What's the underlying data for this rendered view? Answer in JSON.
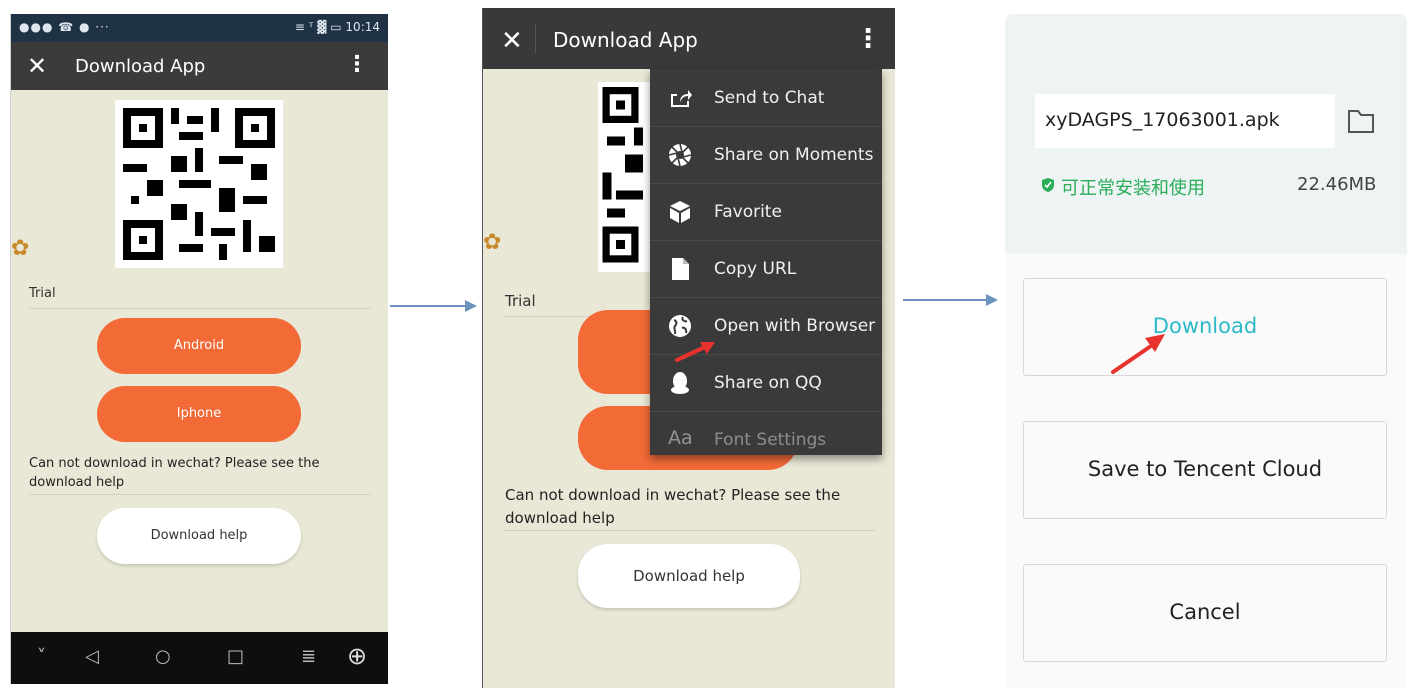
{
  "phone1": {
    "status": {
      "left_icons": "●●● ☎ ● ···",
      "right": "≡ ᵀ ▓ ▭ 10:14"
    },
    "appbar": {
      "close": "✕",
      "title": "Download App",
      "more": "⋮"
    },
    "trial_label": "Trial",
    "android_button": "Android",
    "iphone_button": "Iphone",
    "note": "Can not download in wechat?  Please see the download help",
    "help_button": "Download help",
    "navbar": {
      "down": "˅",
      "back": "◁",
      "home": "○",
      "recent": "□",
      "menu": "≣",
      "plus": "⊕"
    }
  },
  "phone2": {
    "appbar": {
      "close": "✕",
      "title": "Download App",
      "more": "⋮"
    },
    "trial_label": "Trial",
    "note": "Can not download in wechat?  Please see the download help",
    "help_button": "Download help",
    "menu": [
      {
        "label": "Send to Chat",
        "icon": "share-icon"
      },
      {
        "label": "Share on Moments",
        "icon": "moments-icon"
      },
      {
        "label": "Favorite",
        "icon": "cube-icon"
      },
      {
        "label": "Copy URL",
        "icon": "document-icon"
      },
      {
        "label": "Open with Browser",
        "icon": "globe-icon"
      },
      {
        "label": "Share on QQ",
        "icon": "qq-penguin-icon"
      },
      {
        "label": "Font Settings",
        "icon": "font-icon",
        "icon_text": "Aa"
      }
    ]
  },
  "phone3": {
    "filename": "xyDAGPS_17063001.apk",
    "safe_text": "可正常安装和使用",
    "size": "22.46MB",
    "download_button": "Download",
    "save_button": "Save to Tencent Cloud",
    "cancel_button": "Cancel"
  },
  "colors": {
    "accent_orange": "#f26a36",
    "download_teal": "#2bb8c8",
    "safe_green": "#2aae5a",
    "arrow_blue": "#6c93bd",
    "arrow_red": "#e8322e"
  }
}
